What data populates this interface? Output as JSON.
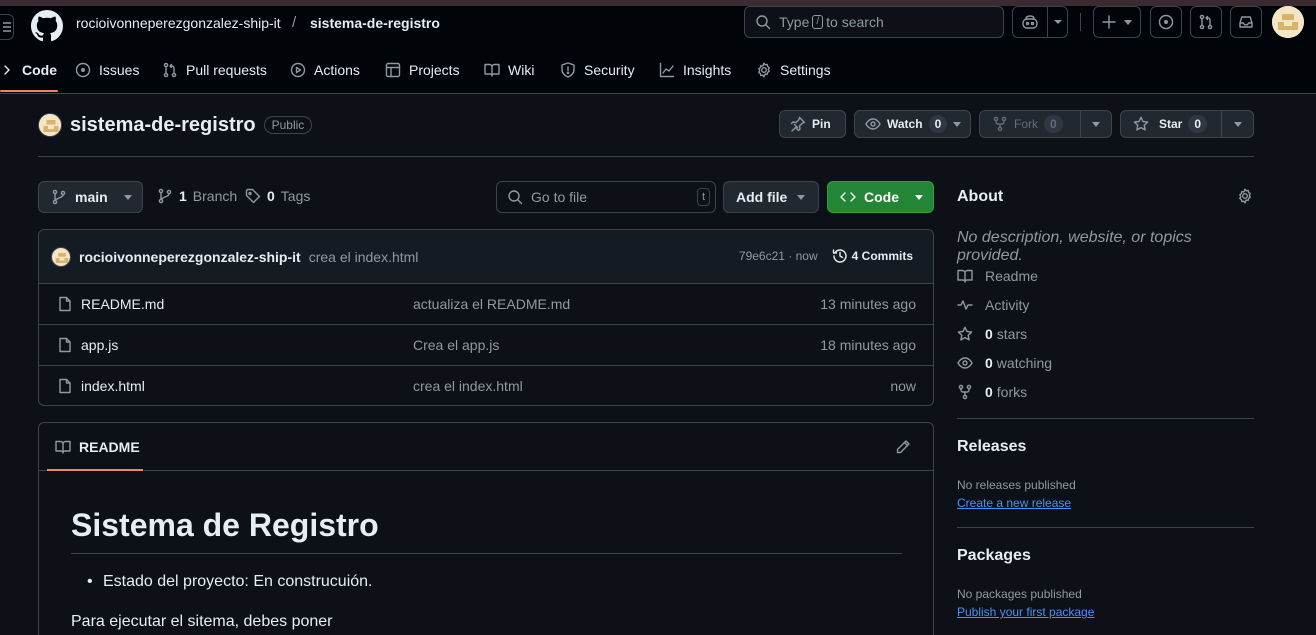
{
  "header": {
    "owner": "rocioivonneperezgonzalez-ship-it",
    "separator": "/",
    "repo": "sistema-de-registro",
    "search_prefix": "Type",
    "search_key": "/",
    "search_suffix": "to search"
  },
  "nav": {
    "code": "Code",
    "issues": "Issues",
    "pulls": "Pull requests",
    "actions": "Actions",
    "projects": "Projects",
    "wiki": "Wiki",
    "security": "Security",
    "insights": "Insights",
    "settings": "Settings"
  },
  "repo": {
    "name": "sistema-de-registro",
    "visibility": "Public",
    "pin_label": "Pin",
    "watch_label": "Watch",
    "watch_count": "0",
    "fork_label": "Fork",
    "fork_count": "0",
    "star_label": "Star",
    "star_count": "0"
  },
  "filebar": {
    "branch": "main",
    "branch_count": "1",
    "branch_label": "Branch",
    "tag_count": "0",
    "tag_label": "Tags",
    "goto_placeholder": "Go to file",
    "goto_key": "t",
    "add_file": "Add file",
    "code": "Code"
  },
  "commit": {
    "author": "rocioivonneperezgonzalez-ship-it",
    "message": "crea el index.html",
    "hash_time": "79e6c21 · now",
    "commits": "4 Commits"
  },
  "files": [
    {
      "name": "README.md",
      "message": "actualiza el README.md",
      "time": "13 minutes ago"
    },
    {
      "name": "app.js",
      "message": "Crea el app.js",
      "time": "18 minutes ago"
    },
    {
      "name": "index.html",
      "message": "crea el index.html",
      "time": "now"
    }
  ],
  "readme": {
    "tab": "README",
    "h1": "Sistema de Registro",
    "bullet": "Estado del proyecto: En construcuión.",
    "paragraph": "Para ejecutar el sitema, debes poner"
  },
  "about": {
    "title": "About",
    "description": "No description, website, or topics provided.",
    "readme": "Readme",
    "activity": "Activity",
    "stars_count": "0",
    "stars_label": "stars",
    "watching_count": "0",
    "watching_label": "watching",
    "forks_count": "0",
    "forks_label": "forks"
  },
  "releases": {
    "title": "Releases",
    "none": "No releases published",
    "create": "Create a new release"
  },
  "packages": {
    "title": "Packages",
    "none": "No packages published",
    "publish": "Publish your first package"
  },
  "colors": {
    "accent_orange": "#f78166",
    "green_button": "#238636",
    "link_blue": "#4493f8"
  }
}
